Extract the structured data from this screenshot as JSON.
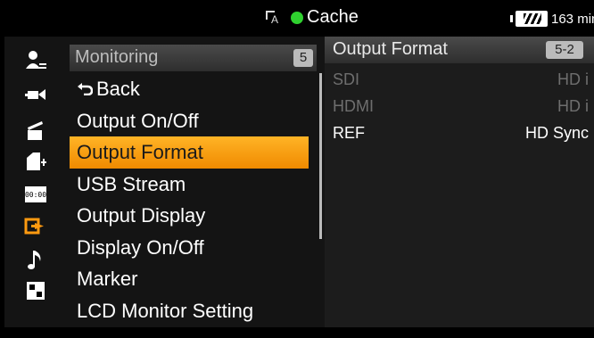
{
  "status": {
    "title": "Cache",
    "battery_text": "163 min"
  },
  "left_icons": [
    {
      "name": "user-settings-icon"
    },
    {
      "name": "camera-settings-icon"
    },
    {
      "name": "clapper-icon"
    },
    {
      "name": "media-icon"
    },
    {
      "name": "timecode-icon",
      "label": "00:00"
    },
    {
      "name": "output-icon"
    },
    {
      "name": "audio-icon"
    },
    {
      "name": "grid-icon"
    }
  ],
  "menu": {
    "title": "Monitoring",
    "page": "5",
    "items": [
      {
        "label": "Back",
        "icon": "back-arrow-icon"
      },
      {
        "label": "Output On/Off"
      },
      {
        "label": "Output Format"
      },
      {
        "label": "USB Stream"
      },
      {
        "label": "Output Display"
      },
      {
        "label": "Display On/Off"
      },
      {
        "label": "Marker"
      },
      {
        "label": "LCD Monitor Setting"
      }
    ]
  },
  "submenu": {
    "title": "Output Format",
    "page": "5-2",
    "rows": [
      {
        "key": "SDI",
        "value": "HD i"
      },
      {
        "key": "HDMI",
        "value": "HD i"
      },
      {
        "key": "REF",
        "value": "HD Sync"
      }
    ]
  },
  "colors": {
    "accent": "#f5a000",
    "active_icon": "#ff9a10",
    "rec_dot": "#2fd12f"
  }
}
